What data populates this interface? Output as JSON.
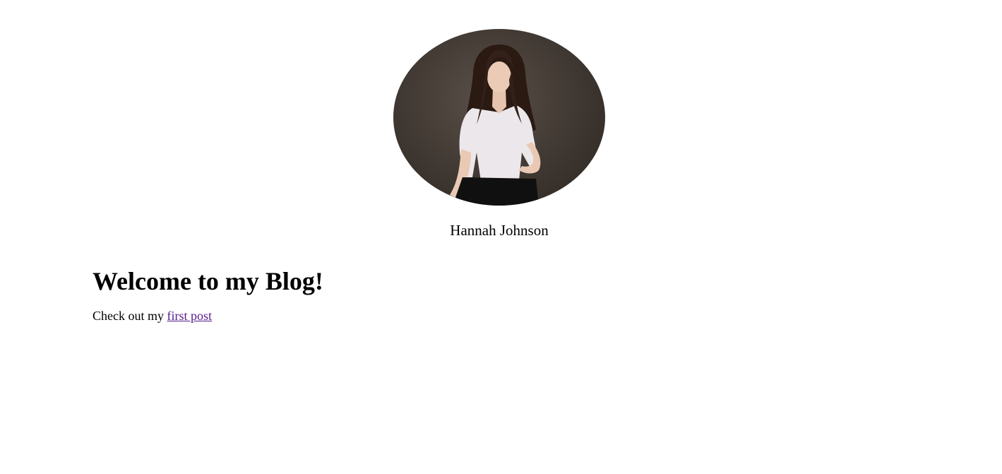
{
  "profile": {
    "avatar_icon": "portrait-photo",
    "name": "Hannah Johnson"
  },
  "main": {
    "title": "Welcome to my Blog!",
    "intro_text": "Check out my ",
    "link_text": "first post"
  },
  "colors": {
    "link_visited": "#551a8b",
    "background": "#ffffff",
    "text": "#000000"
  }
}
